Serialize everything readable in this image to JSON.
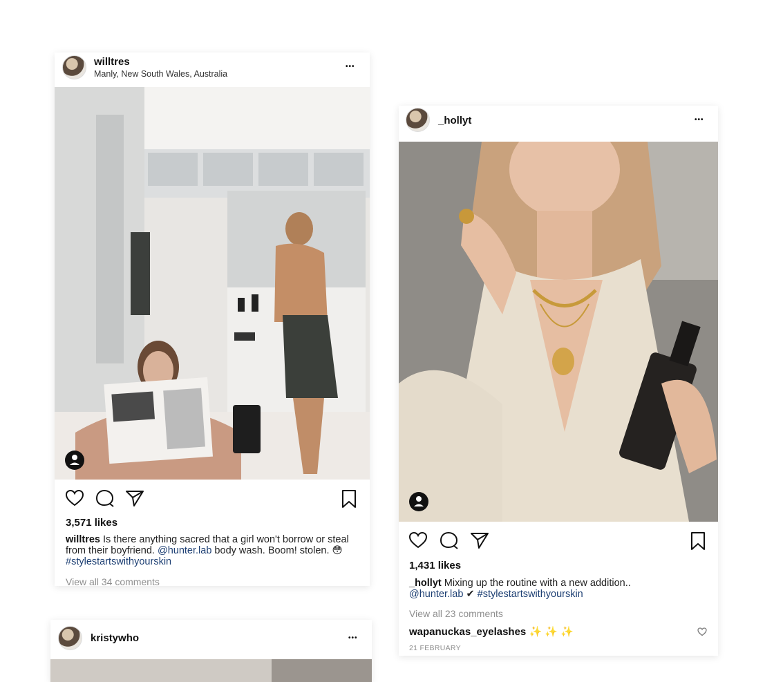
{
  "posts": [
    {
      "username": "willtres",
      "location": "Manly, New South Wales, Australia",
      "more": "•••",
      "likes": "3,571 likes",
      "caption_user": "willtres",
      "caption_text": " Is there anything sacred that a girl won't borrow or steal from their boyfriend. ",
      "caption_mention": "@hunter.lab",
      "caption_text2": " body wash. Boom! stolen. 😳 ",
      "caption_hashtag": "#stylestartswithyourskin",
      "view_all": "View all 34 comments"
    },
    {
      "username": "_hollyt",
      "more": "•••",
      "likes": "1,431 likes",
      "caption_user": "_hollyt",
      "caption_text": " Mixing up the routine with a new addition..",
      "caption_mention": "@hunter.lab",
      "caption_check": " ✔ ",
      "caption_hashtag": "#stylestartswithyourskin",
      "view_all": "View all 23 comments",
      "comment_user": "wapanuckas_eyelashes",
      "comment_emoji": " ✨ ✨ ✨",
      "date": "21 FEBRUARY"
    },
    {
      "username": "kristywho",
      "more": "•••"
    }
  ],
  "icons": [
    "heart-icon",
    "comment-icon",
    "share-icon",
    "bookmark-icon",
    "user-tag-icon",
    "small-heart-icon"
  ],
  "colors": {
    "link": "#1d3f73",
    "muted": "#8e8e8e"
  }
}
